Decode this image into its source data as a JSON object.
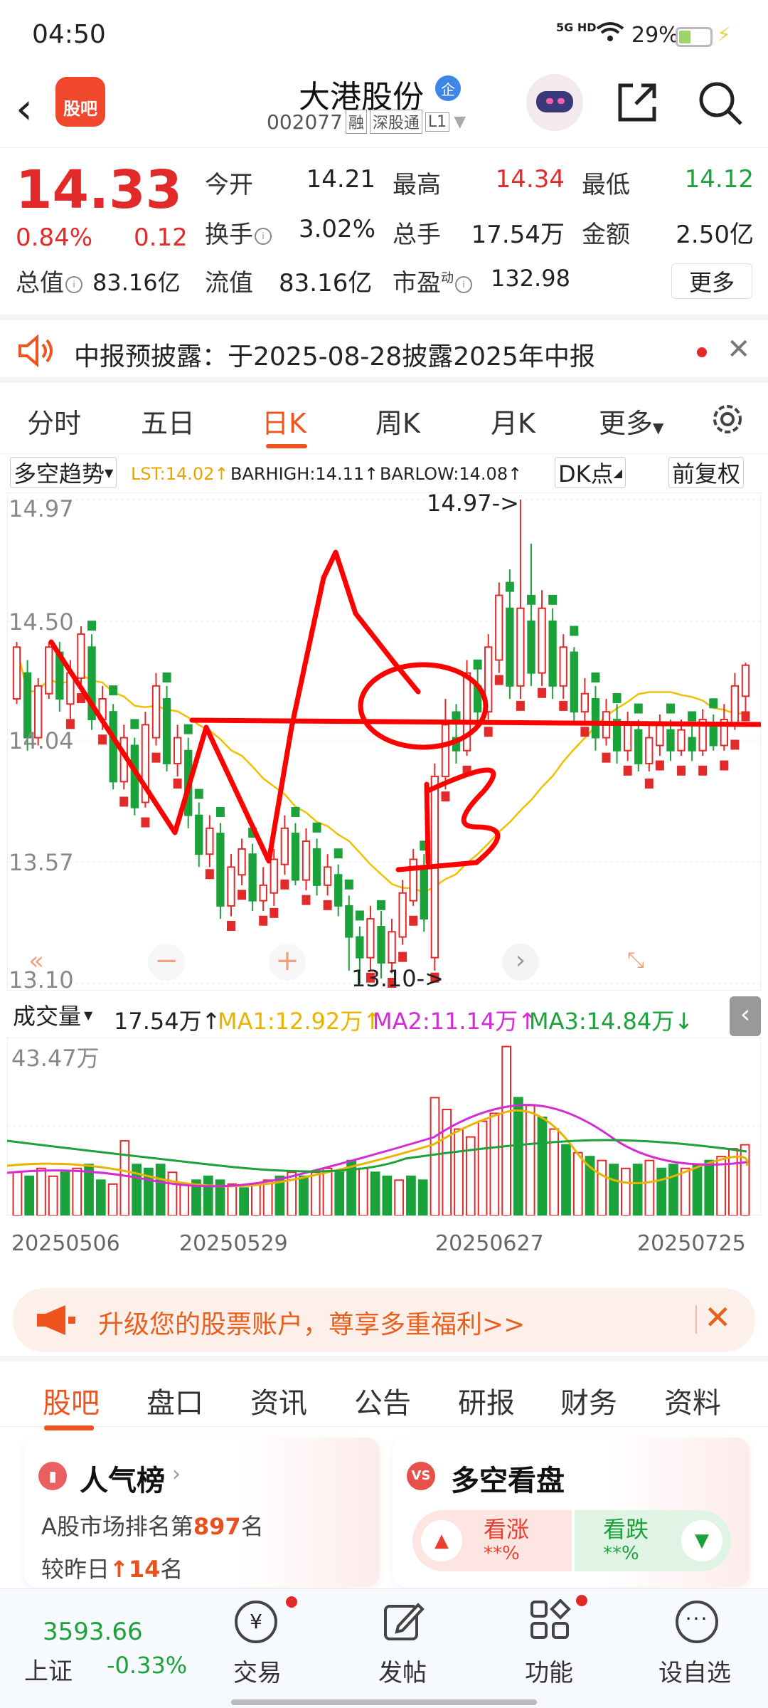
{
  "status": {
    "time": "04:50",
    "net": "5G HD",
    "battery": "29%"
  },
  "header": {
    "logo_text": "股吧",
    "stock_name": "大港股份",
    "verify_badge": "企",
    "code": "002077",
    "tags": [
      "融",
      "深股通",
      "L1"
    ]
  },
  "quote": {
    "price": "14.33",
    "change_pct": "0.84%",
    "change": "0.12",
    "rows": [
      [
        {
          "label": "今开",
          "value": "14.21",
          "cls": ""
        },
        {
          "label": "最高",
          "value": "14.34",
          "cls": "red"
        },
        {
          "label": "最低",
          "value": "14.12",
          "cls": "green"
        }
      ],
      [
        {
          "label": "换手",
          "value": "3.02%",
          "cls": "",
          "info": true
        },
        {
          "label": "总手",
          "value": "17.54万",
          "cls": ""
        },
        {
          "label": "金额",
          "value": "2.50亿",
          "cls": ""
        }
      ]
    ],
    "row3": [
      {
        "label": "总值",
        "value": "83.16亿",
        "info": true
      },
      {
        "label": "流值",
        "value": "83.16亿"
      },
      {
        "label": "市盈",
        "sup": "动",
        "value": "132.98",
        "info": true
      }
    ],
    "more": "更多"
  },
  "notice": {
    "text": "中报预披露：于2025-08-28披露2025年中报"
  },
  "tabs": [
    "分时",
    "五日",
    "日K",
    "周K",
    "月K",
    "更多"
  ],
  "chart_toolbar": {
    "indicator": "多空趋势",
    "lst": "LST:14.02",
    "barhigh": "BARHIGH:14.11",
    "barlow": "BARLOW:14.08",
    "dk": "DK点",
    "adjust": "前复权"
  },
  "chart_data": {
    "type": "candlestick",
    "y_ticks": [
      "14.97",
      "14.50",
      "14.04",
      "13.57",
      "13.10"
    ],
    "ylim": [
      13.1,
      14.97
    ],
    "annotations": [
      "14.97->",
      "13.10->"
    ],
    "volume_label": "成交量",
    "volume_value": "17.54万",
    "ma1": "MA1:12.92万",
    "ma2": "MA2:11.14万",
    "ma3": "MA3:14.84万",
    "volume_max": "43.47万",
    "x_labels": [
      "20250506",
      "20250529",
      "20250627",
      "20250725"
    ],
    "candles": [
      [
        14.2,
        14.4,
        14.42,
        14.18,
        1
      ],
      [
        14.3,
        14.05,
        14.35,
        14.0,
        0
      ],
      [
        14.05,
        14.25,
        14.28,
        14.02,
        1
      ],
      [
        14.22,
        14.4,
        14.42,
        14.2,
        1
      ],
      [
        14.38,
        14.2,
        14.42,
        14.15,
        0
      ],
      [
        14.18,
        14.3,
        14.35,
        14.1,
        1
      ],
      [
        14.28,
        14.45,
        14.48,
        14.25,
        1
      ],
      [
        14.4,
        14.12,
        14.45,
        14.08,
        0
      ],
      [
        14.12,
        14.2,
        14.25,
        14.08,
        1
      ],
      [
        14.15,
        13.88,
        14.18,
        13.85,
        0
      ],
      [
        13.88,
        14.05,
        14.1,
        13.85,
        1
      ],
      [
        14.02,
        13.78,
        14.05,
        13.75,
        0
      ],
      [
        13.8,
        14.1,
        14.15,
        13.78,
        1
      ],
      [
        14.05,
        14.25,
        14.3,
        14.02,
        1
      ],
      [
        14.2,
        13.95,
        14.25,
        13.92,
        0
      ],
      [
        13.95,
        14.05,
        14.1,
        13.9,
        1
      ],
      [
        14.0,
        13.75,
        14.05,
        13.7,
        0
      ],
      [
        13.75,
        13.6,
        13.8,
        13.55,
        0
      ],
      [
        13.6,
        13.7,
        13.75,
        13.55,
        1
      ],
      [
        13.68,
        13.4,
        13.72,
        13.35,
        0
      ],
      [
        13.4,
        13.55,
        13.6,
        13.36,
        1
      ],
      [
        13.52,
        13.62,
        13.66,
        13.48,
        1
      ],
      [
        13.6,
        13.42,
        13.64,
        13.38,
        0
      ],
      [
        13.42,
        13.48,
        13.55,
        13.38,
        1
      ],
      [
        13.45,
        13.58,
        13.62,
        13.4,
        1
      ],
      [
        13.56,
        13.7,
        13.75,
        13.52,
        1
      ],
      [
        13.68,
        13.5,
        13.72,
        13.48,
        0
      ],
      [
        13.5,
        13.65,
        13.7,
        13.46,
        1
      ],
      [
        13.62,
        13.48,
        13.66,
        13.44,
        0
      ],
      [
        13.48,
        13.55,
        13.6,
        13.44,
        1
      ],
      [
        13.52,
        13.4,
        13.56,
        13.36,
        0
      ],
      [
        13.4,
        13.28,
        13.44,
        13.15,
        0
      ],
      [
        13.28,
        13.2,
        13.32,
        13.1,
        0
      ],
      [
        13.2,
        13.35,
        13.4,
        13.15,
        1
      ],
      [
        13.32,
        13.18,
        13.38,
        13.12,
        0
      ],
      [
        13.18,
        13.3,
        13.35,
        13.14,
        1
      ],
      [
        13.28,
        13.45,
        13.5,
        13.25,
        1
      ],
      [
        13.42,
        13.58,
        13.62,
        13.4,
        1
      ],
      [
        13.55,
        13.35,
        13.6,
        13.3,
        0
      ],
      [
        13.2,
        13.9,
        13.95,
        13.15,
        1
      ],
      [
        13.9,
        14.1,
        14.2,
        13.85,
        1
      ],
      [
        14.05,
        14.0,
        14.18,
        13.95,
        0
      ],
      [
        14.0,
        14.3,
        14.35,
        13.98,
        1
      ],
      [
        14.25,
        14.15,
        14.32,
        14.1,
        0
      ],
      [
        14.15,
        14.4,
        14.45,
        14.12,
        1
      ],
      [
        14.35,
        14.6,
        14.65,
        14.3,
        1
      ],
      [
        14.55,
        14.25,
        14.7,
        14.2,
        0
      ],
      [
        14.25,
        14.55,
        14.97,
        14.2,
        1
      ],
      [
        14.5,
        14.3,
        14.8,
        14.25,
        0
      ],
      [
        14.3,
        14.55,
        14.62,
        14.25,
        1
      ],
      [
        14.5,
        14.25,
        14.55,
        14.2,
        0
      ],
      [
        14.25,
        14.4,
        14.45,
        14.2,
        1
      ],
      [
        14.38,
        14.15,
        14.4,
        14.1,
        0
      ],
      [
        14.15,
        14.22,
        14.28,
        14.1,
        1
      ],
      [
        14.2,
        14.05,
        14.25,
        14.0,
        0
      ],
      [
        14.05,
        14.15,
        14.2,
        14.02,
        1
      ],
      [
        14.12,
        14.0,
        14.18,
        13.95,
        0
      ],
      [
        14.0,
        14.1,
        14.15,
        13.96,
        1
      ],
      [
        14.08,
        13.95,
        14.12,
        13.92,
        0
      ],
      [
        13.95,
        14.05,
        14.1,
        13.92,
        1
      ],
      [
        14.02,
        14.1,
        14.14,
        13.98,
        1
      ],
      [
        14.08,
        14.0,
        14.12,
        13.96,
        0
      ],
      [
        14.0,
        14.08,
        14.12,
        13.98,
        1
      ],
      [
        14.05,
        14.0,
        14.1,
        13.96,
        0
      ],
      [
        14.0,
        14.12,
        14.16,
        13.98,
        1
      ],
      [
        14.1,
        14.02,
        14.14,
        14.0,
        0
      ],
      [
        14.02,
        14.12,
        14.18,
        14.0,
        1
      ],
      [
        14.1,
        14.25,
        14.3,
        14.08,
        1
      ],
      [
        14.21,
        14.33,
        14.34,
        14.12,
        1
      ]
    ],
    "volumes": [
      [
        11,
        1
      ],
      [
        10,
        0
      ],
      [
        12,
        1
      ],
      [
        10,
        1
      ],
      [
        11,
        0
      ],
      [
        12,
        1
      ],
      [
        13,
        0
      ],
      [
        9,
        0
      ],
      [
        8,
        1
      ],
      [
        19,
        1
      ],
      [
        13,
        0
      ],
      [
        12,
        0
      ],
      [
        13,
        0
      ],
      [
        11,
        1
      ],
      [
        8,
        1
      ],
      [
        9,
        0
      ],
      [
        10,
        0
      ],
      [
        9,
        0
      ],
      [
        8,
        1
      ],
      [
        7,
        0
      ],
      [
        8,
        1
      ],
      [
        9,
        1
      ],
      [
        10,
        0
      ],
      [
        11,
        1
      ],
      [
        10,
        0
      ],
      [
        11,
        1
      ],
      [
        12,
        1
      ],
      [
        11,
        0
      ],
      [
        14,
        0
      ],
      [
        12,
        1
      ],
      [
        11,
        0
      ],
      [
        10,
        0
      ],
      [
        9,
        1
      ],
      [
        10,
        0
      ],
      [
        9,
        0
      ],
      [
        30,
        1
      ],
      [
        27,
        1
      ],
      [
        22,
        1
      ],
      [
        20,
        1
      ],
      [
        24,
        1
      ],
      [
        26,
        1
      ],
      [
        43,
        1
      ],
      [
        30,
        0
      ],
      [
        28,
        1
      ],
      [
        25,
        0
      ],
      [
        22,
        1
      ],
      [
        18,
        0
      ],
      [
        16,
        1
      ],
      [
        15,
        0
      ],
      [
        14,
        1
      ],
      [
        13,
        0
      ],
      [
        12,
        1
      ],
      [
        13,
        0
      ],
      [
        14,
        1
      ],
      [
        12,
        0
      ],
      [
        13,
        0
      ],
      [
        12,
        1
      ],
      [
        13,
        0
      ],
      [
        14,
        0
      ],
      [
        15,
        1
      ],
      [
        17,
        1
      ],
      [
        18,
        1
      ]
    ]
  },
  "promo": {
    "text": "升级您的股票账户，尊享多重福利>>"
  },
  "bottom_tabs": [
    "股吧",
    "盘口",
    "资讯",
    "公告",
    "研报",
    "财务",
    "资料"
  ],
  "cards": {
    "popularity": {
      "title": "人气榜",
      "rank_prefix": "A股市场排名第",
      "rank": "897",
      "rank_suffix": "名",
      "compare_prefix": "较昨日",
      "compare": "14",
      "compare_suffix": "名"
    },
    "bull_bear": {
      "title": "多空看盘",
      "up_label": "看涨",
      "up_value": "**%",
      "down_label": "看跌",
      "down_value": "**%"
    }
  },
  "bottom_nav": {
    "index_value": "3593.66",
    "index_name": "上证",
    "index_change": "-0.33%",
    "items": [
      "交易",
      "发帖",
      "功能",
      "设自选"
    ]
  }
}
